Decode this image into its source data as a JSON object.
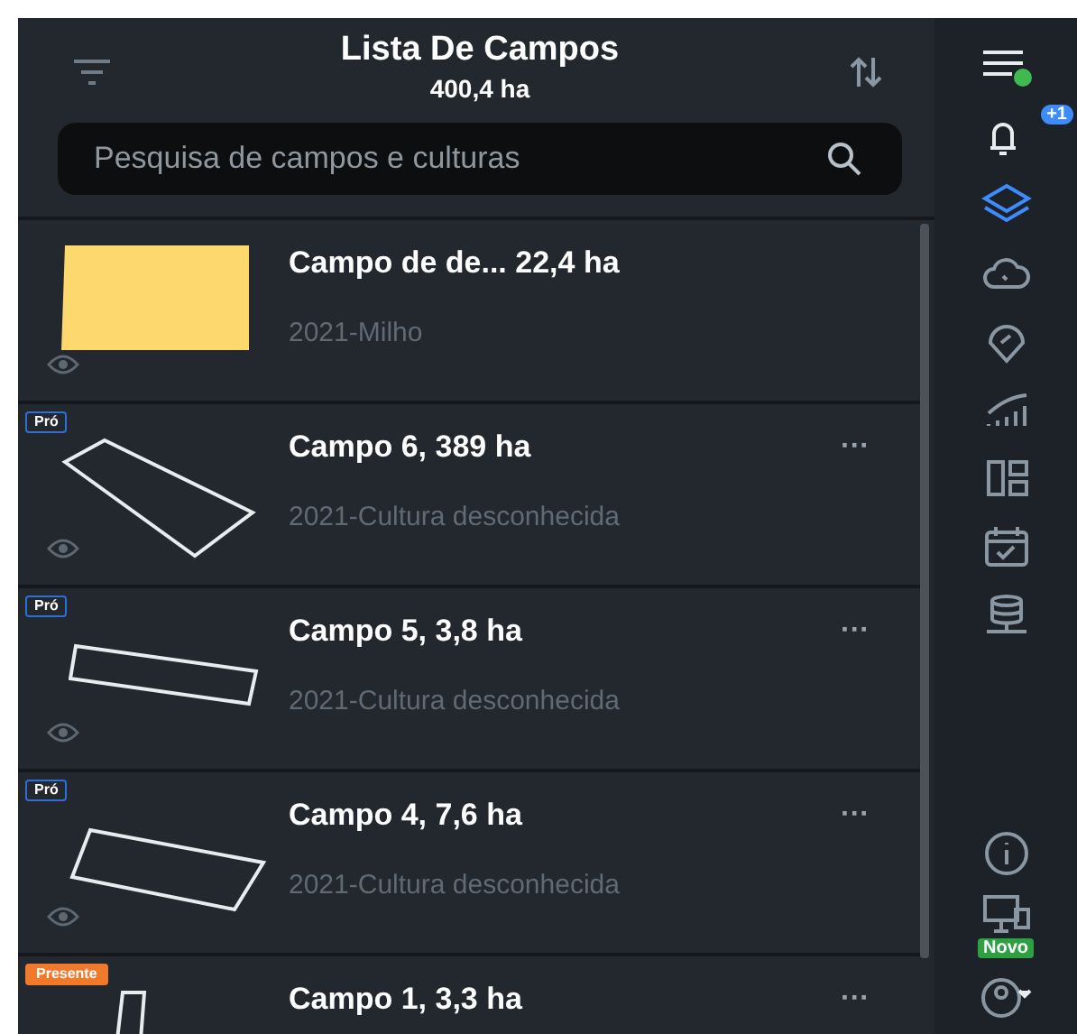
{
  "header": {
    "title": "Lista De Campos",
    "total": "400,4 ha"
  },
  "search": {
    "placeholder": "Pesquisa de campos e culturas"
  },
  "fields": [
    {
      "name": "Campo de de... 22,4 ha",
      "crop": "2021-Milho",
      "color": "#fcd86e"
    },
    {
      "name": "Campo 6, 389 ha",
      "crop": "2021-Cultura desconhecida",
      "badge": {
        "label": "Pró",
        "kind": "outline"
      },
      "more": "···"
    },
    {
      "name": "Campo 5, 3,8 ha",
      "crop": "2021-Cultura desconhecida",
      "badge": {
        "label": "Pró",
        "kind": "outline"
      },
      "more": "···"
    },
    {
      "name": "Campo 4, 7,6 ha",
      "crop": "2021-Cultura desconhecida",
      "badge": {
        "label": "Pró",
        "kind": "outline"
      },
      "more": "···"
    },
    {
      "name": "Campo 1, 3,3 ha",
      "badge": {
        "label": "Presente",
        "kind": "filled"
      },
      "more": "···"
    }
  ],
  "nav": [
    {
      "kind": "menu",
      "selected": false
    },
    {
      "kind": "bell",
      "selected": false,
      "badge": "+1"
    },
    {
      "kind": "layers",
      "selected": true
    },
    {
      "kind": "cloud",
      "selected": false
    },
    {
      "kind": "pin",
      "selected": false
    },
    {
      "kind": "bars",
      "selected": false
    },
    {
      "kind": "dashboard",
      "selected": false
    },
    {
      "kind": "calendar",
      "selected": false
    },
    {
      "kind": "database",
      "selected": false
    }
  ],
  "nav_bottom": [
    {
      "kind": "info"
    },
    {
      "kind": "screen",
      "badge": "Novo"
    },
    {
      "kind": "user"
    }
  ]
}
